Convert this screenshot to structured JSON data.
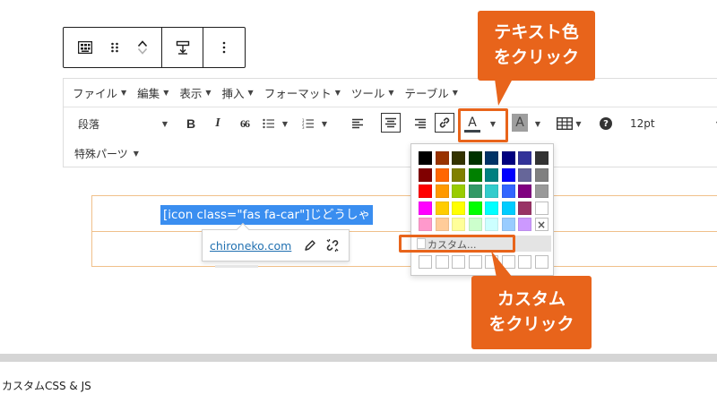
{
  "menubar": {
    "items": [
      {
        "label": "ファイル"
      },
      {
        "label": "編集"
      },
      {
        "label": "表示"
      },
      {
        "label": "挿入"
      },
      {
        "label": "フォーマット"
      },
      {
        "label": "ツール"
      },
      {
        "label": "テーブル"
      }
    ]
  },
  "toolbar": {
    "paragraph_select": "段落",
    "bold": "B",
    "italic": "I",
    "blockquote": "66",
    "text_color_letter": "A",
    "bg_color_letter": "A",
    "help": "?",
    "font_size": "12pt",
    "special_parts": "特殊パーツ",
    "text_color_bar": "#3c434a"
  },
  "content": {
    "shortcode_text": "[icon class=\"fas fa-car\"]じどうしゃ"
  },
  "link_popup": {
    "url": "chironeko.com"
  },
  "color_picker": {
    "rows": [
      [
        "#000000",
        "#993300",
        "#333300",
        "#003300",
        "#003366",
        "#000080",
        "#333399",
        "#333333"
      ],
      [
        "#800000",
        "#ff6600",
        "#808000",
        "#008000",
        "#008080",
        "#0000ff",
        "#666699",
        "#808080"
      ],
      [
        "#ff0000",
        "#ff9900",
        "#99cc00",
        "#339966",
        "#33cccc",
        "#3366ff",
        "#800080",
        "#999999"
      ],
      [
        "#ff00ff",
        "#ffcc00",
        "#ffff00",
        "#00ff00",
        "#00ffff",
        "#00ccff",
        "#993366",
        "#ffffff"
      ],
      [
        "#ff99cc",
        "#ffcc99",
        "#ffff99",
        "#ccffcc",
        "#ccffff",
        "#99ccff",
        "#cc99ff"
      ]
    ],
    "remove_symbol": "×",
    "custom_label": "カスタム..."
  },
  "annotations": {
    "callout_text_color": [
      "テキスト色",
      "をクリック"
    ],
    "callout_custom": [
      "カスタム",
      "をクリック"
    ],
    "accent_color": "#e8641b"
  },
  "bottom": {
    "custom_css_js": "カスタムCSS & JS"
  }
}
